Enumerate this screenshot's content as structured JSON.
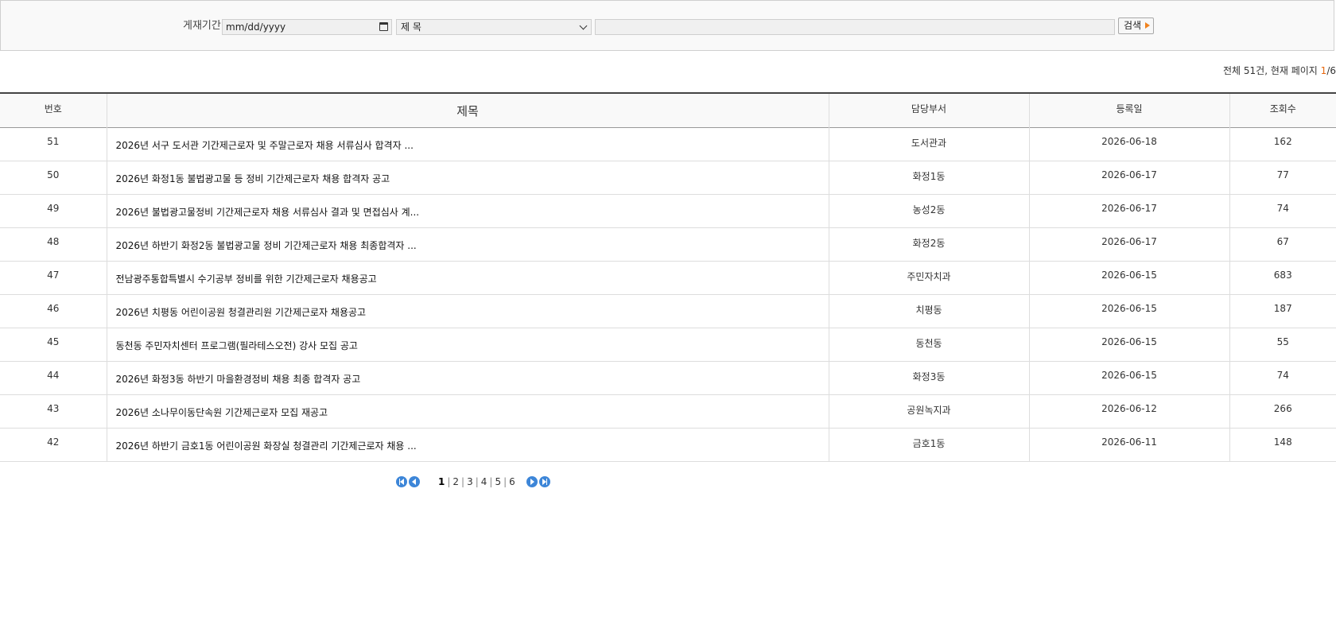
{
  "search": {
    "period_label": "게재기간 :",
    "date_placeholder": "mm/dd/yyyy",
    "select_value": "제 목",
    "keyword_value": "",
    "button_label": "검색"
  },
  "summary": {
    "prefix": "전체 51건, 현재 페이지 ",
    "current": "1",
    "suffix": "/6"
  },
  "table": {
    "headers": [
      "번호",
      "제목",
      "담당부서",
      "등록일",
      "조회수"
    ],
    "rows": [
      [
        "51",
        "2026년 서구 도서관 기간제근로자 및 주말근로자 채용 서류심사 합격자 ...",
        "도서관과",
        "2026-06-18",
        "162"
      ],
      [
        "50",
        "2026년 화정1동 불법광고물 등 정비 기간제근로자 채용 합격자 공고",
        "화정1동",
        "2026-06-17",
        "77"
      ],
      [
        "49",
        "2026년 불법광고물정비 기간제근로자 채용 서류심사 결과 및 면접심사 계...",
        "농성2동",
        "2026-06-17",
        "74"
      ],
      [
        "48",
        "2026년 하반기 화정2동 불법광고물 정비 기간제근로자 채용 최종합격자 ...",
        "화정2동",
        "2026-06-17",
        "67"
      ],
      [
        "47",
        "전남광주통합특별시 수기공부 정비를 위한 기간제근로자 채용공고",
        "주민자치과",
        "2026-06-15",
        "683"
      ],
      [
        "46",
        "2026년 치평동 어린이공원 청결관리원 기간제근로자 채용공고",
        "치평동",
        "2026-06-15",
        "187"
      ],
      [
        "45",
        "동천동 주민자치센터 프로그램(필라테스오전) 강사 모집 공고",
        "동천동",
        "2026-06-15",
        "55"
      ],
      [
        "44",
        "2026년 화정3동 하반기 마을환경정비 채용 최종 합격자 공고",
        "화정3동",
        "2026-06-15",
        "74"
      ],
      [
        "43",
        "2026년 소나무이동단속원 기간제근로자 모집 재공고",
        "공원녹지과",
        "2026-06-12",
        "266"
      ],
      [
        "42",
        "2026년 하반기 금호1동 어린이공원 화장실 청결관리 기간제근로자 채용 ...",
        "금호1동",
        "2026-06-11",
        "148"
      ]
    ]
  },
  "pager": {
    "pages": [
      "1",
      "2",
      "3",
      "4",
      "5",
      "6"
    ],
    "current": "1"
  },
  "colors": {
    "accent_orange": "#e8680e",
    "pager_blue": "#3d86d8"
  }
}
